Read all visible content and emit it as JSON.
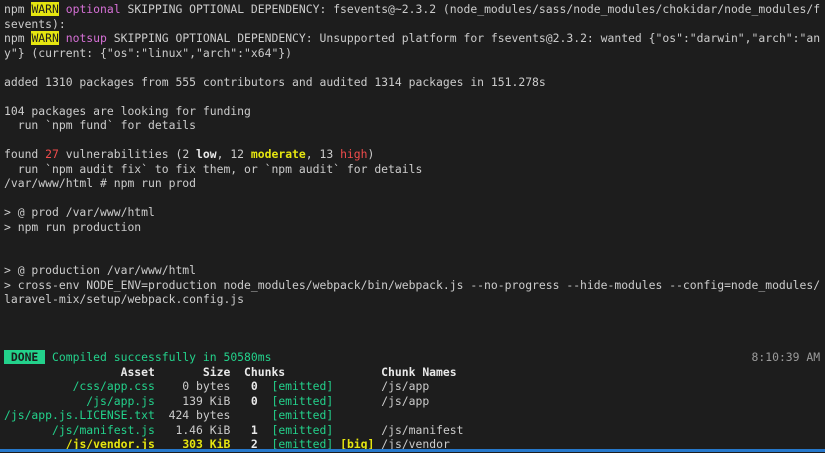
{
  "colors": {
    "background": "#1d1d1d",
    "foreground": "#cccccc",
    "green": "#23d18b",
    "yellow": "#e5e510",
    "red": "#f14c4c",
    "magenta": "#d670d6",
    "gray": "#9a9a9a",
    "bottom_bar_blue": "#2678cb"
  },
  "terminal": {
    "lines": [
      {
        "name": "npm-warn-optional-line",
        "segments": [
          {
            "t": "npm ",
            "c": "fg"
          },
          {
            "t": "WARN",
            "c": "warn-badge",
            "n": "warn-badge"
          },
          {
            "t": " ",
            "c": "fg"
          },
          {
            "t": "optional",
            "c": "magenta",
            "n": "warn-type"
          },
          {
            "t": " SKIPPING OPTIONAL DEPENDENCY: fsevents@~2.3.2 (node_modules/sass/node_modules/chokidar/node_modules/f",
            "c": "fg"
          }
        ]
      },
      {
        "name": "npm-warn-optional-wrap",
        "segments": [
          {
            "t": "sevents):",
            "c": "fg"
          }
        ]
      },
      {
        "name": "npm-warn-notsup-line",
        "segments": [
          {
            "t": "npm ",
            "c": "fg"
          },
          {
            "t": "WARN",
            "c": "warn-badge",
            "n": "warn-badge"
          },
          {
            "t": " ",
            "c": "fg"
          },
          {
            "t": "notsup",
            "c": "magenta",
            "n": "warn-type"
          },
          {
            "t": " SKIPPING OPTIONAL DEPENDENCY: Unsupported platform for fsevents@2.3.2: wanted {\"os\":\"darwin\",\"arch\":\"an",
            "c": "fg"
          }
        ]
      },
      {
        "name": "npm-warn-notsup-wrap",
        "segments": [
          {
            "t": "y\"} (current: {\"os\":\"linux\",\"arch\":\"x64\"})",
            "c": "fg"
          }
        ]
      },
      {
        "name": "blank-line",
        "segments": []
      },
      {
        "name": "added-packages-line",
        "segments": [
          {
            "t": "added 1310 packages from 555 contributors and audited 1314 packages in 151.278s",
            "c": "fg"
          }
        ]
      },
      {
        "name": "blank-line",
        "segments": []
      },
      {
        "name": "funding-line",
        "segments": [
          {
            "t": "104 packages are looking for funding",
            "c": "fg"
          }
        ]
      },
      {
        "name": "funding-hint-line",
        "segments": [
          {
            "t": "  run `npm fund` for details",
            "c": "fg"
          }
        ]
      },
      {
        "name": "blank-line",
        "segments": []
      },
      {
        "name": "vulnerabilities-line",
        "segments": [
          {
            "t": "found ",
            "c": "fg"
          },
          {
            "t": "27",
            "c": "red",
            "n": "vuln-count"
          },
          {
            "t": " vulnerabilities (2 ",
            "c": "fg"
          },
          {
            "t": "low",
            "c": "bold",
            "n": "low-label"
          },
          {
            "t": ", 12 ",
            "c": "fg"
          },
          {
            "t": "moderate",
            "c": "yellow",
            "n": "moderate-label"
          },
          {
            "t": ", 13 ",
            "c": "fg"
          },
          {
            "t": "high",
            "c": "red",
            "n": "high-label"
          },
          {
            "t": ")",
            "c": "fg"
          }
        ]
      },
      {
        "name": "audit-hint-line",
        "segments": [
          {
            "t": "  run `npm audit fix` to fix them, or `npm audit` for details",
            "c": "fg"
          }
        ]
      },
      {
        "name": "shell-prompt-line",
        "segments": [
          {
            "t": "/var/www/html # npm run prod",
            "c": "fg"
          }
        ]
      },
      {
        "name": "blank-line",
        "segments": []
      },
      {
        "name": "script-prod-line",
        "segments": [
          {
            "t": "> @ prod /var/www/html",
            "c": "fg"
          }
        ]
      },
      {
        "name": "script-run-production-line",
        "segments": [
          {
            "t": "> npm run production",
            "c": "fg"
          }
        ]
      },
      {
        "name": "blank-line",
        "segments": []
      },
      {
        "name": "blank-line",
        "segments": []
      },
      {
        "name": "script-production-line",
        "segments": [
          {
            "t": "> @ production /var/www/html",
            "c": "fg"
          }
        ]
      },
      {
        "name": "webpack-command-line",
        "segments": [
          {
            "t": "> cross-env NODE_ENV=production node_modules/webpack/bin/webpack.js --no-progress --hide-modules --config=node_modules/",
            "c": "fg"
          }
        ]
      },
      {
        "name": "webpack-command-wrap",
        "segments": [
          {
            "t": "laravel-mix/setup/webpack.config.js",
            "c": "fg"
          }
        ]
      },
      {
        "name": "blank-line",
        "segments": []
      },
      {
        "name": "blank-line",
        "segments": []
      },
      {
        "name": "blank-line",
        "segments": []
      },
      {
        "name": "done-line",
        "segments": [
          {
            "t": " DONE ",
            "c": "done-badge",
            "n": "done-badge"
          },
          {
            "t": " ",
            "c": "fg"
          },
          {
            "t": "Compiled successfully in 50580ms",
            "c": "green",
            "n": "compile-message"
          },
          {
            "t": "                                                                      ",
            "c": "fg"
          },
          {
            "t": "8:10:39 AM",
            "c": "gray",
            "n": "timestamp"
          }
        ]
      },
      {
        "name": "asset-table-header",
        "segments": [
          {
            "t": "                 Asset       Size  Chunks              Chunk Names",
            "c": "bold",
            "n": "table-header"
          }
        ]
      },
      {
        "name": "asset-row-css-app",
        "segments": [
          {
            "t": "          ",
            "c": "fg"
          },
          {
            "t": "/css/app.css",
            "c": "green",
            "n": "asset-name"
          },
          {
            "t": "    0 bytes",
            "c": "fg",
            "n": "asset-size"
          },
          {
            "t": "   0",
            "c": "bold",
            "n": "chunk-id"
          },
          {
            "t": "  ",
            "c": "fg"
          },
          {
            "t": "[emitted]",
            "c": "green",
            "n": "emitted-flag"
          },
          {
            "t": "       /js/app",
            "c": "fg",
            "n": "chunk-name"
          }
        ]
      },
      {
        "name": "asset-row-js-app",
        "segments": [
          {
            "t": "            ",
            "c": "fg"
          },
          {
            "t": "/js/app.js",
            "c": "green",
            "n": "asset-name"
          },
          {
            "t": "    139 KiB",
            "c": "fg",
            "n": "asset-size"
          },
          {
            "t": "   0",
            "c": "bold",
            "n": "chunk-id"
          },
          {
            "t": "  ",
            "c": "fg"
          },
          {
            "t": "[emitted]",
            "c": "green",
            "n": "emitted-flag"
          },
          {
            "t": "       /js/app",
            "c": "fg",
            "n": "chunk-name"
          }
        ]
      },
      {
        "name": "asset-row-license",
        "segments": [
          {
            "t": "/js/app.js.LICENSE.txt",
            "c": "green",
            "n": "asset-name"
          },
          {
            "t": "  424 bytes",
            "c": "fg",
            "n": "asset-size"
          },
          {
            "t": "    ",
            "c": "fg"
          },
          {
            "t": "  ",
            "c": "fg"
          },
          {
            "t": "[emitted]",
            "c": "green",
            "n": "emitted-flag"
          }
        ]
      },
      {
        "name": "asset-row-manifest",
        "segments": [
          {
            "t": "       ",
            "c": "fg"
          },
          {
            "t": "/js/manifest.js",
            "c": "green",
            "n": "asset-name"
          },
          {
            "t": "   1.46 KiB",
            "c": "fg",
            "n": "asset-size"
          },
          {
            "t": "   1",
            "c": "bold",
            "n": "chunk-id"
          },
          {
            "t": "  ",
            "c": "fg"
          },
          {
            "t": "[emitted]",
            "c": "green",
            "n": "emitted-flag"
          },
          {
            "t": "       /js/manifest",
            "c": "fg",
            "n": "chunk-name"
          }
        ]
      },
      {
        "name": "asset-row-vendor",
        "segments": [
          {
            "t": "         ",
            "c": "fg"
          },
          {
            "t": "/js/vendor.js",
            "c": "yellow",
            "n": "asset-name"
          },
          {
            "t": "    ",
            "c": "fg"
          },
          {
            "t": "303 KiB",
            "c": "yellow",
            "n": "asset-size"
          },
          {
            "t": "   2",
            "c": "bold",
            "n": "chunk-id"
          },
          {
            "t": "  ",
            "c": "fg"
          },
          {
            "t": "[emitted]",
            "c": "green",
            "n": "emitted-flag"
          },
          {
            "t": " ",
            "c": "fg"
          },
          {
            "t": "[big]",
            "c": "yellow",
            "n": "big-flag"
          },
          {
            "t": " /js/vendor",
            "c": "fg",
            "n": "chunk-name"
          }
        ]
      }
    ]
  }
}
